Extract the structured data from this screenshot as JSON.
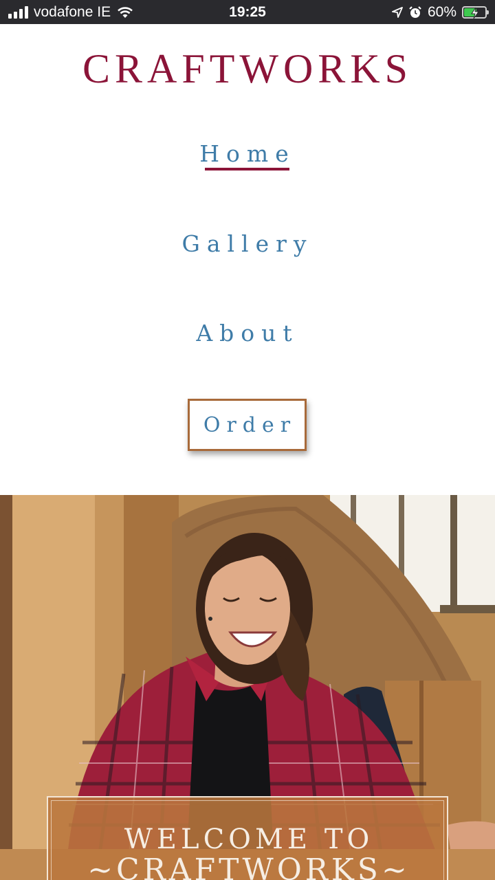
{
  "status_bar": {
    "carrier": "vodafone IE",
    "time": "19:25",
    "battery": "60%",
    "battery_level": 0.6,
    "icons": [
      "signal-icon",
      "wifi-icon",
      "location-arrow-icon",
      "alarm-icon",
      "battery-charging-icon"
    ]
  },
  "header": {
    "brand": "CRAFTWORKS"
  },
  "nav": {
    "home": "Home",
    "gallery": "Gallery",
    "about": "About",
    "order": "Order",
    "active": "Home"
  },
  "hero": {
    "welcome_line1": "WELCOME TO",
    "welcome_line2": "~CRAFTWORKS~"
  },
  "colors": {
    "brand": "#8b1438",
    "nav_text": "#3f7ca8",
    "order_border": "#a86a3a",
    "welcome_box": "#ba763e",
    "status_bar_bg": "#2a2a2e"
  }
}
